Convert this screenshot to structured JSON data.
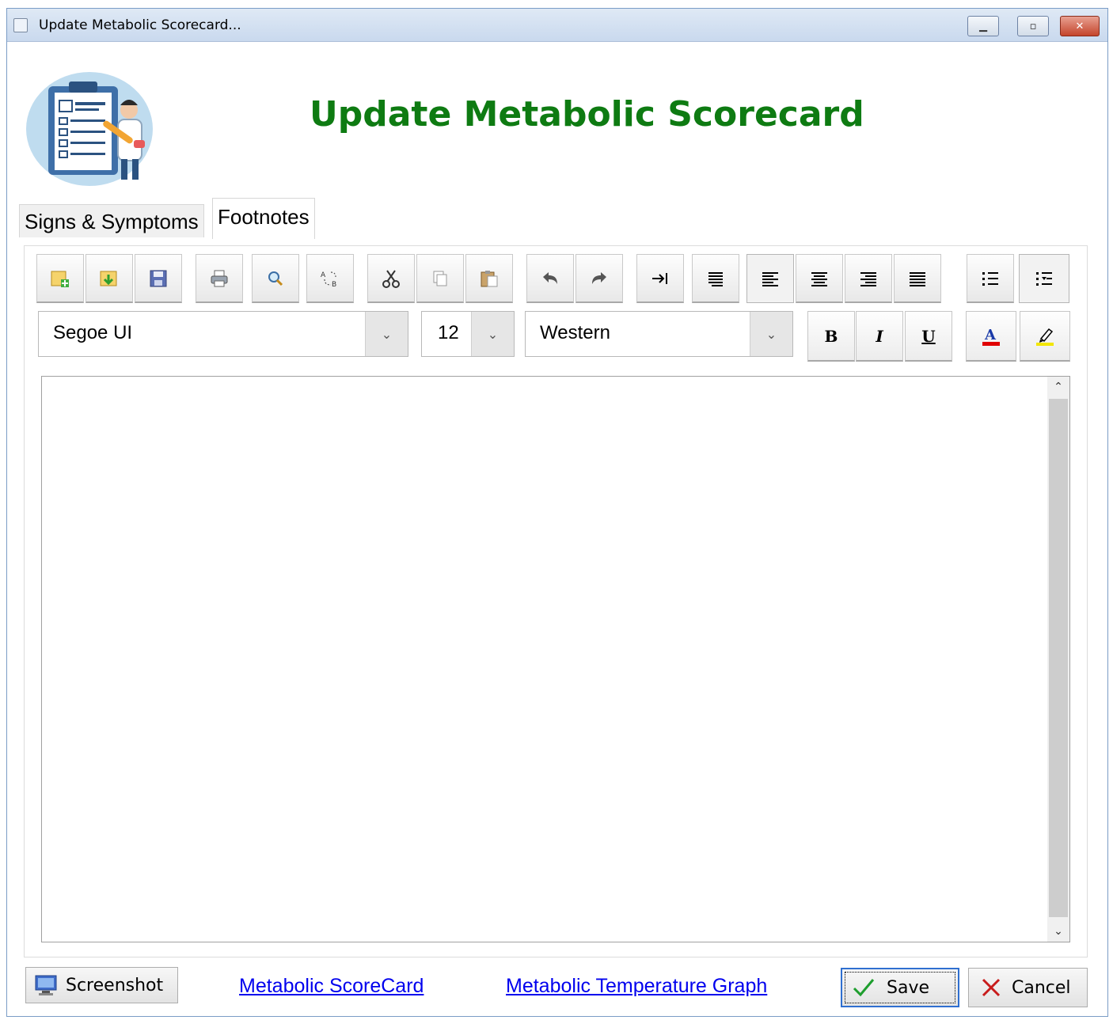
{
  "window": {
    "title": "Update Metabolic Scorecard...",
    "controls": {
      "minimize": "▁",
      "maximize": "▫",
      "close": "✕"
    }
  },
  "header": {
    "title": "Update Metabolic Scorecard",
    "title_color": "#0e7b12"
  },
  "tabs": [
    {
      "label": "Signs & Symptoms",
      "selected": false
    },
    {
      "label": "Footnotes",
      "selected": true
    }
  ],
  "toolbar": {
    "buttons": [
      "new-document-icon",
      "open-document-icon",
      "save-icon",
      "print-icon",
      "find-icon",
      "replace-icon",
      "cut-icon",
      "copy-icon",
      "paste-icon",
      "undo-icon",
      "redo-icon",
      "indent-icon",
      "paragraph-icon",
      "align-left-icon",
      "align-center-icon",
      "align-right-icon",
      "justify-icon",
      "bullet-list-icon",
      "numbered-list-icon"
    ],
    "active_alignment": "align-left"
  },
  "format": {
    "font_family": "Segoe UI",
    "font_size": "12",
    "script": "Western",
    "bold_label": "B",
    "italic_label": "I",
    "underline_label": "U",
    "font_color": "#e00000",
    "highlight_color": "#f2e600"
  },
  "editor": {
    "content": ""
  },
  "footer": {
    "screenshot_label": "Screenshot",
    "link_scorecard": "Metabolic ScoreCard",
    "link_temperature": "Metabolic Temperature Graph",
    "save_label": "Save",
    "cancel_label": "Cancel"
  }
}
